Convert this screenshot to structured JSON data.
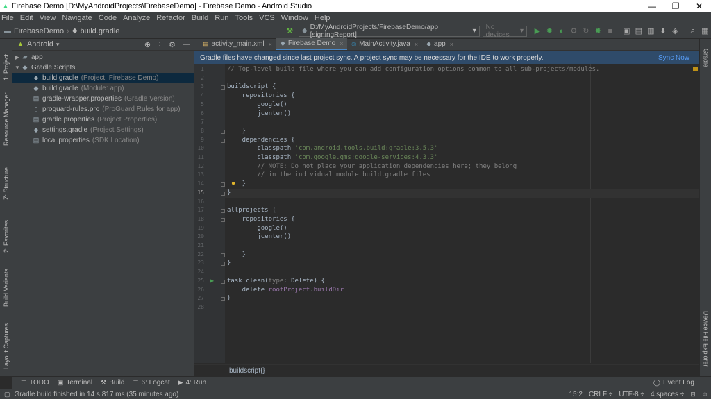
{
  "window": {
    "title": "Firebase Demo [D:\\MyAndroidProjects\\FirebaseDemo] - Firebase Demo - Android Studio",
    "controls": [
      "—",
      "❐",
      "✕"
    ]
  },
  "menu": [
    "File",
    "Edit",
    "View",
    "Navigate",
    "Code",
    "Analyze",
    "Refactor",
    "Build",
    "Run",
    "Tools",
    "VCS",
    "Window",
    "Help"
  ],
  "nav": {
    "project": "FirebaseDemo",
    "file": "build.gradle",
    "run_config": "D:/MyAndroidProjects/FirebaseDemo/app [signingReport]",
    "devices": "No devices"
  },
  "left_tabs": [
    "1: Project",
    "Resource Manager",
    "Z: Structure",
    "2: Favorites",
    "Build Variants",
    "Layout Captures"
  ],
  "right_tabs": [
    "Gradle",
    "Device File Explorer"
  ],
  "project_panel": {
    "view": "Android",
    "tree": [
      {
        "name": "app",
        "hint": "",
        "indent": 0,
        "arrow": "▶",
        "icon": "folder"
      },
      {
        "name": "Gradle Scripts",
        "hint": "",
        "indent": 0,
        "arrow": "▼",
        "icon": "gradle"
      },
      {
        "name": "build.gradle",
        "hint": "(Project: Firebase Demo)",
        "indent": 1,
        "arrow": "",
        "icon": "gradle",
        "selected": true
      },
      {
        "name": "build.gradle",
        "hint": "(Module: app)",
        "indent": 1,
        "arrow": "",
        "icon": "gradle"
      },
      {
        "name": "gradle-wrapper.properties",
        "hint": "(Gradle Version)",
        "indent": 1,
        "arrow": "",
        "icon": "props"
      },
      {
        "name": "proguard-rules.pro",
        "hint": "(ProGuard Rules for app)",
        "indent": 1,
        "arrow": "",
        "icon": "file"
      },
      {
        "name": "gradle.properties",
        "hint": "(Project Properties)",
        "indent": 1,
        "arrow": "",
        "icon": "props"
      },
      {
        "name": "settings.gradle",
        "hint": "(Project Settings)",
        "indent": 1,
        "arrow": "",
        "icon": "gradle"
      },
      {
        "name": "local.properties",
        "hint": "(SDK Location)",
        "indent": 1,
        "arrow": "",
        "icon": "props"
      }
    ]
  },
  "editor_tabs": [
    {
      "label": "activity_main.xml",
      "active": false
    },
    {
      "label": "Firebase Demo",
      "active": true
    },
    {
      "label": "MainActivity.java",
      "active": false
    },
    {
      "label": "app",
      "active": false
    }
  ],
  "sync_bar": {
    "message": "Gradle files have changed since last project sync. A project sync may be necessary for the IDE to work properly.",
    "action": "Sync Now"
  },
  "code_lines": [
    [
      {
        "t": "// Top-level build file where you can add configuration options common to all sub-projects/modules.",
        "c": "com"
      }
    ],
    [],
    [
      {
        "t": "buildscript {",
        "c": ""
      }
    ],
    [
      {
        "t": "    repositories {",
        "c": ""
      }
    ],
    [
      {
        "t": "        google()",
        "c": ""
      }
    ],
    [
      {
        "t": "        jcenter()",
        "c": ""
      }
    ],
    [],
    [
      {
        "t": "    }",
        "c": ""
      }
    ],
    [
      {
        "t": "    dependencies {",
        "c": ""
      }
    ],
    [
      {
        "t": "        classpath ",
        "c": ""
      },
      {
        "t": "'com.android.tools.build:gradle:3.5.3'",
        "c": "str"
      }
    ],
    [
      {
        "t": "        classpath ",
        "c": ""
      },
      {
        "t": "'com.google.gms:google-services:4.3.3'",
        "c": "str"
      }
    ],
    [
      {
        "t": "        // NOTE: Do not place your application dependencies here; they belong",
        "c": "com"
      }
    ],
    [
      {
        "t": "        // in the individual module build.gradle files",
        "c": "com"
      }
    ],
    [
      {
        "t": "    }",
        "c": ""
      }
    ],
    [
      {
        "t": "}",
        "c": ""
      }
    ],
    [],
    [
      {
        "t": "allprojects {",
        "c": ""
      }
    ],
    [
      {
        "t": "    repositories {",
        "c": ""
      }
    ],
    [
      {
        "t": "        google()",
        "c": ""
      }
    ],
    [
      {
        "t": "        jcenter()",
        "c": ""
      }
    ],
    [],
    [
      {
        "t": "    }",
        "c": ""
      }
    ],
    [
      {
        "t": "}",
        "c": ""
      }
    ],
    [],
    [
      {
        "t": "task clean(",
        "c": ""
      },
      {
        "t": "type",
        "c": "com"
      },
      {
        "t": ": Delete) {",
        "c": ""
      }
    ],
    [
      {
        "t": "    delete ",
        "c": ""
      },
      {
        "t": "rootProject",
        "c": "fld"
      },
      {
        "t": ".",
        "c": ""
      },
      {
        "t": "buildDir",
        "c": "fld"
      }
    ],
    [
      {
        "t": "}",
        "c": ""
      }
    ],
    []
  ],
  "current_line": 15,
  "editor_breadcrumb": "buildscript{}",
  "bottom_tools": [
    {
      "label": "TODO",
      "icon": "☰"
    },
    {
      "label": "Terminal",
      "icon": "▣"
    },
    {
      "label": "Build",
      "icon": "⚒"
    },
    {
      "label": "6: Logcat",
      "icon": "☰"
    },
    {
      "label": "4: Run",
      "icon": "▶"
    }
  ],
  "event_log": "Event Log",
  "status": {
    "message": "Gradle build finished in 14 s 817 ms (35 minutes ago)",
    "position": "15:2",
    "line_sep": "CRLF ÷",
    "encoding": "UTF-8 ÷",
    "indent": "4 spaces ÷"
  }
}
